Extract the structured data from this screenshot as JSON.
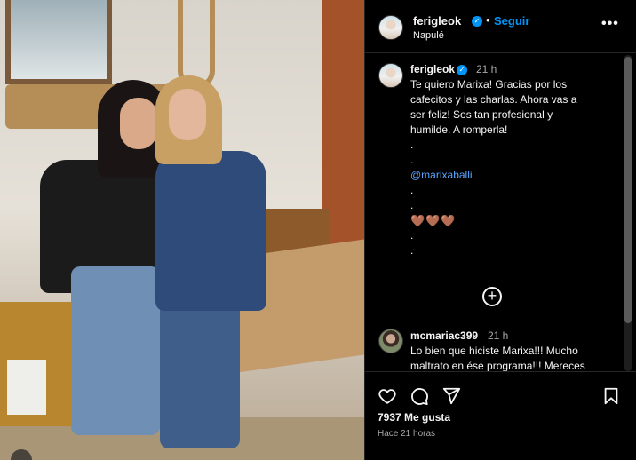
{
  "post": {
    "photo_alt": "Two women posing together in a restaurant",
    "author": {
      "username": "ferigleok",
      "verified": true,
      "follow_label": "Seguir",
      "location": "Napulé"
    },
    "more_icon": "more-horizontal-icon"
  },
  "caption": {
    "username": "ferigleok",
    "time": "21 h",
    "lines": [
      "Te quiero Marixa! Gracias por los",
      "cafecitos y las charlas. Ahora vas a",
      "ser feliz! Sos tan profesional y",
      "humilde. A romperla!",
      ".",
      ".",
      "@marixaballi",
      ".",
      ".",
      "🤎🤎🤎",
      ".",
      "."
    ]
  },
  "load_more_icon": "plus-circle-icon",
  "comment": {
    "username": "mcmariac399",
    "time": "21 h",
    "lines": [
      "Lo bien que hiciste Marixa!!! Mucho",
      "maltrato en ése programa!!! Mereces"
    ]
  },
  "actions": {
    "icons": [
      "heart-icon",
      "comment-icon",
      "share-icon",
      "save-icon"
    ],
    "likes": "7937 Me gusta",
    "posted": "Hace 21 horas"
  },
  "colors": {
    "background": "#000000",
    "accent": "#0095f6",
    "text": "#f5f5f5",
    "muted": "#a8a8a8",
    "divider": "#262626"
  }
}
